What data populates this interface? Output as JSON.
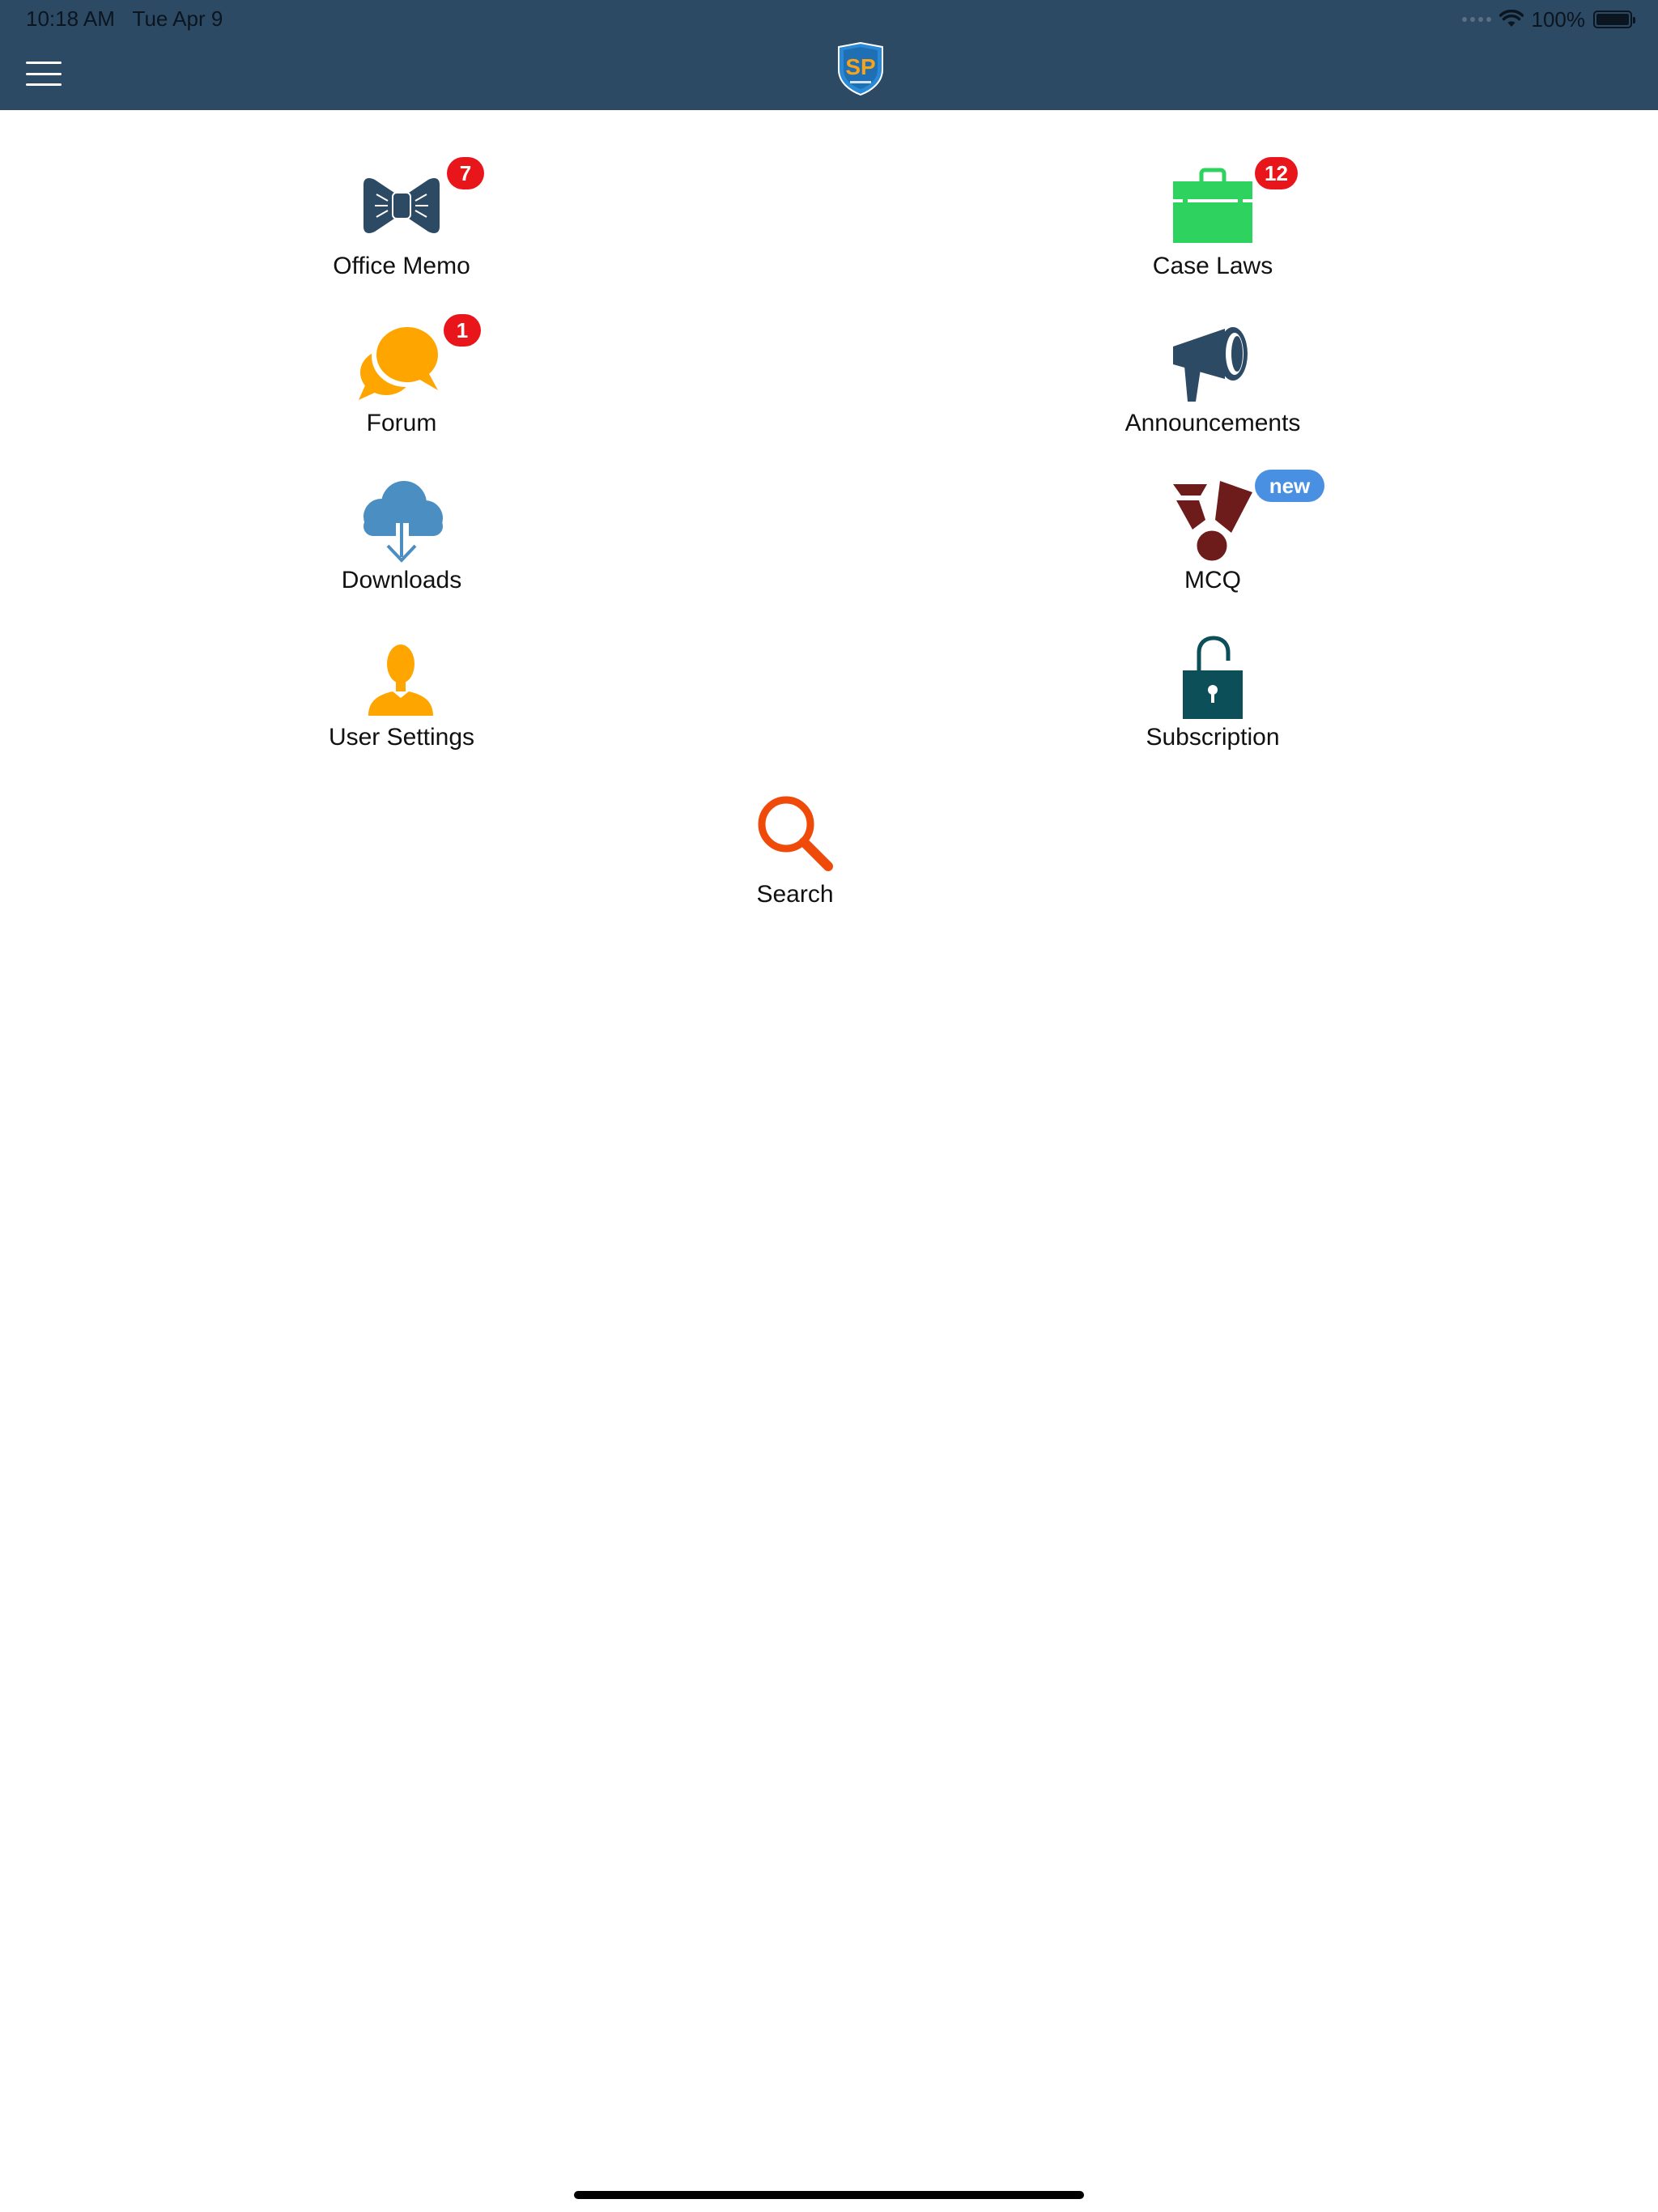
{
  "status_bar": {
    "time": "10:18 AM",
    "date": "Tue Apr 9",
    "battery": "100%",
    "battery_level": 1.0
  },
  "header": {
    "menu_icon": "hamburger-menu-icon",
    "logo_text": "SP",
    "bar_color": "#2d4a64"
  },
  "menu": {
    "office_memo": {
      "label": "Office Memo",
      "badge": "7",
      "icon": "bow-tie-icon",
      "color": "#2d4a64"
    },
    "case_laws": {
      "label": "Case Laws",
      "badge": "12",
      "icon": "briefcase-icon",
      "color": "#2ed35f"
    },
    "forum": {
      "label": "Forum",
      "badge": "1",
      "icon": "chat-bubbles-icon",
      "color": "#ffa500"
    },
    "announcements": {
      "label": "Announcements",
      "icon": "megaphone-icon",
      "color": "#2d4a64"
    },
    "downloads": {
      "label": "Downloads",
      "icon": "cloud-download-icon",
      "color": "#4a8ec2"
    },
    "mcq": {
      "label": "MCQ",
      "badge": "new",
      "icon": "medal-icon",
      "color": "#6e1b1b"
    },
    "user_settings": {
      "label": "User Settings",
      "icon": "user-icon",
      "color": "#ffa500"
    },
    "subscription": {
      "label": "Subscription",
      "icon": "unlocked-padlock-icon",
      "color": "#0d4f58"
    },
    "search": {
      "label": "Search",
      "icon": "search-icon",
      "color": "#f04a0a"
    }
  },
  "colors": {
    "badge_red": "#e8151b",
    "badge_blue": "#4a90e2"
  }
}
